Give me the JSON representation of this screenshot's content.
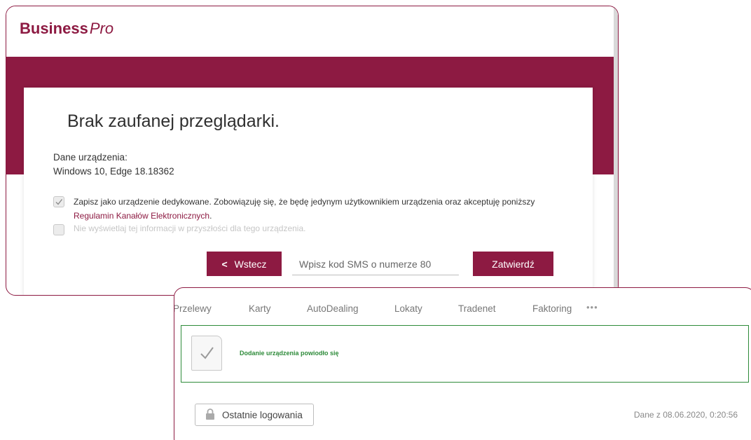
{
  "trust_dialog": {
    "logo": {
      "bold": "Business",
      "italic": "Pro"
    },
    "title": "Brak zaufanej przeglądarki.",
    "device_label": "Dane urządzenia:",
    "device_value": "Windows 10, Edge 18.18362",
    "dedicated_checkbox": {
      "checked": true,
      "text_before_link": "Zapisz jako urządzenie dedykowane. Zobowiązuję się, że będę jedynym użytkownikiem urządzenia oraz akceptuję poniższy ",
      "link": "Regulamin Kanałów Elektronicznych",
      "text_after_link": "."
    },
    "dont_show_checkbox": {
      "checked": false,
      "text": "Nie wyświetlaj tej informacji w przyszłości dla tego urządzenia."
    },
    "back_button": "Wstecz",
    "sms_placeholder": "Wpisz kod SMS o numerze 80",
    "confirm_button": "Zatwierdź"
  },
  "dashboard": {
    "nav": [
      "Przelewy",
      "Karty",
      "AutoDealing",
      "Lokaty",
      "Tradenet",
      "Faktoring"
    ],
    "nav_more": "•••",
    "success_message": "Dodanie urządzenia powiodło się",
    "last_logins_button": "Ostatnie logowania",
    "data_date": "Dane z 08.06.2020, 0:20:56"
  },
  "colors": {
    "brand": "#8d1a42",
    "success": "#2e8b3a"
  }
}
